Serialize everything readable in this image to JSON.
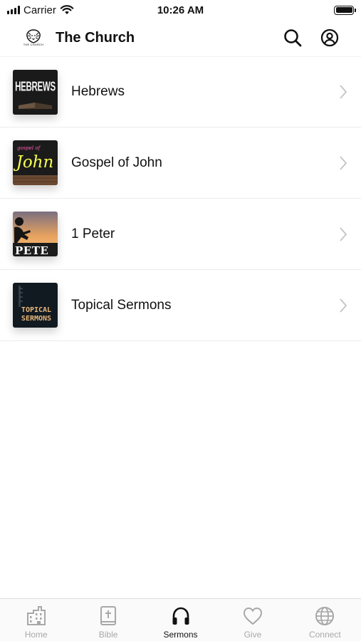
{
  "status_bar": {
    "carrier": "Carrier",
    "time": "10:26 AM"
  },
  "header": {
    "logo_caption": "THE CHURCH",
    "title": "The Church",
    "icons": [
      "search-icon",
      "account-icon"
    ]
  },
  "series_list": [
    {
      "title": "Hebrews",
      "thumb_text": "HEBREWS",
      "thumb_colors": [
        "#1a1a1a",
        "#3a3a3a"
      ]
    },
    {
      "title": "Gospel of John",
      "thumb_text": "John",
      "thumb_small_text": "gospel of",
      "thumb_colors": [
        "#1b1b1b",
        "#f7ff4f",
        "#ff5fb0"
      ]
    },
    {
      "title": "1 Peter",
      "thumb_text": "PETE",
      "thumb_colors": [
        "#f4b061",
        "#7c6a78",
        "#1d1d1d"
      ]
    },
    {
      "title": "Topical Sermons",
      "thumb_text_line1": "TOPICAL",
      "thumb_text_line2": "SERMONS",
      "thumb_colors": [
        "#121a21",
        "#e8b77a"
      ]
    }
  ],
  "tab_bar": {
    "active": "Sermons",
    "tabs": [
      {
        "label": "Home",
        "icon": "building-icon"
      },
      {
        "label": "Bible",
        "icon": "bible-icon"
      },
      {
        "label": "Sermons",
        "icon": "headphones-icon"
      },
      {
        "label": "Give",
        "icon": "heart-icon"
      },
      {
        "label": "Connect",
        "icon": "globe-icon"
      }
    ]
  }
}
